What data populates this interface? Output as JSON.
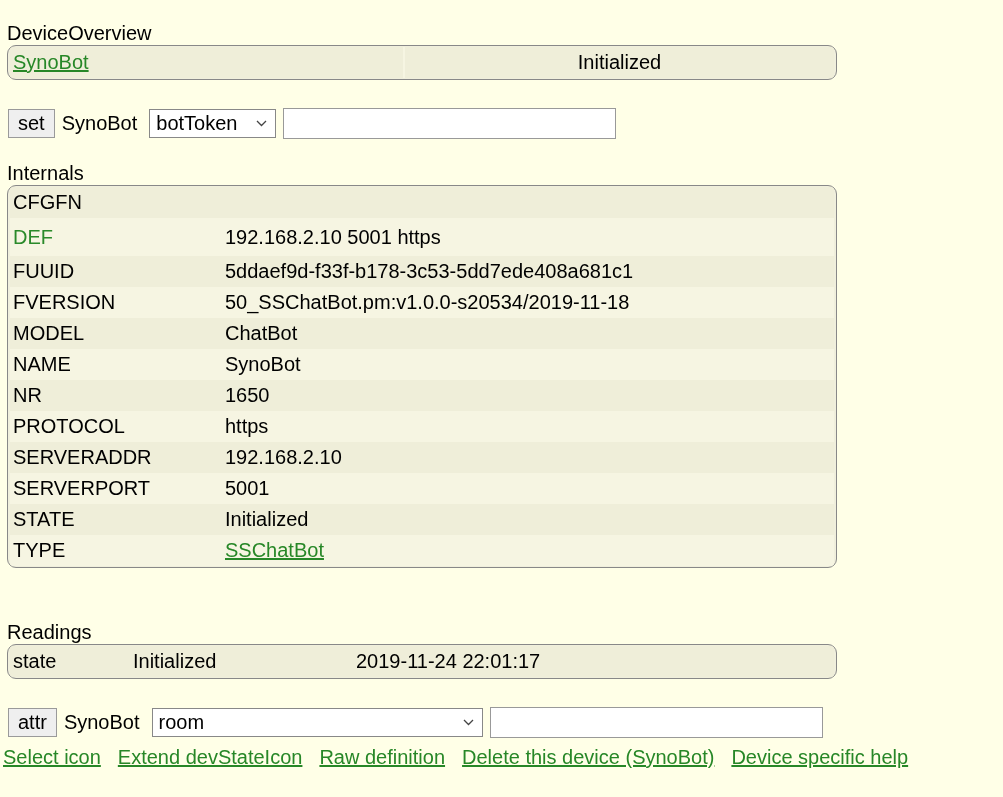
{
  "device_overview": {
    "title": "DeviceOverview",
    "device": "SynoBot",
    "state": "Initialized"
  },
  "set_command": {
    "button": "set",
    "device": "SynoBot",
    "selected_option": "botToken"
  },
  "internals": {
    "title": "Internals",
    "rows": [
      {
        "key": "CFGFN",
        "value": "",
        "key_green": false,
        "value_link": false
      },
      {
        "key": "DEF",
        "value": "192.168.2.10 5001 https",
        "key_green": true,
        "value_link": false
      },
      {
        "key": "FUUID",
        "value": "5ddaef9d-f33f-b178-3c53-5dd7ede408a681c1",
        "key_green": false,
        "value_link": false
      },
      {
        "key": "FVERSION",
        "value": "50_SSChatBot.pm:v1.0.0-s20534/2019-11-18",
        "key_green": false,
        "value_link": false
      },
      {
        "key": "MODEL",
        "value": "ChatBot",
        "key_green": false,
        "value_link": false
      },
      {
        "key": "NAME",
        "value": "SynoBot",
        "key_green": false,
        "value_link": false
      },
      {
        "key": "NR",
        "value": "1650",
        "key_green": false,
        "value_link": false
      },
      {
        "key": "PROTOCOL",
        "value": "https",
        "key_green": false,
        "value_link": false
      },
      {
        "key": "SERVERADDR",
        "value": "192.168.2.10",
        "key_green": false,
        "value_link": false
      },
      {
        "key": "SERVERPORT",
        "value": "5001",
        "key_green": false,
        "value_link": false
      },
      {
        "key": "STATE",
        "value": "Initialized",
        "key_green": false,
        "value_link": false
      },
      {
        "key": "TYPE",
        "value": "SSChatBot",
        "key_green": false,
        "value_link": true
      }
    ]
  },
  "readings": {
    "title": "Readings",
    "rows": [
      {
        "name": "state",
        "value": "Initialized",
        "time": "2019-11-24 22:01:17"
      }
    ]
  },
  "attr_command": {
    "button": "attr",
    "device": "SynoBot",
    "selected_option": "room"
  },
  "links": [
    "Select icon",
    "Extend devStateIcon",
    "Raw definition",
    "Delete this device (SynoBot)",
    "Device specific help"
  ]
}
